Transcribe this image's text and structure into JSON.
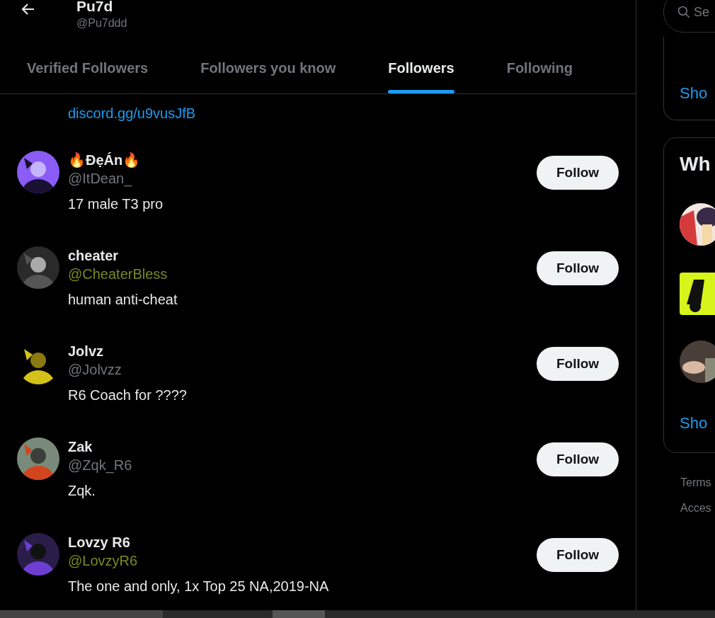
{
  "header": {
    "title": "Pu7d",
    "handle": "@Pu7ddd"
  },
  "tabs": [
    {
      "label": "Verified Followers",
      "selected": false
    },
    {
      "label": "Followers you know",
      "selected": false
    },
    {
      "label": "Followers",
      "selected": true
    },
    {
      "label": "Following",
      "selected": false
    }
  ],
  "partial_user": {
    "bio": "discord.gg/u9vusJfB"
  },
  "users": [
    {
      "name": "🔥ĐẹÁn🔥",
      "handle": "@ItDean_",
      "color": "#71767b",
      "bio": "17 male T3 pro",
      "follow": "Follow"
    },
    {
      "name": "cheater",
      "handle": "@CheaterBless",
      "color": "#7a8a1f",
      "bio": "human anti-cheat",
      "follow": "Follow"
    },
    {
      "name": "Jolvz",
      "handle": "@Jolvzz",
      "color": "#71767b",
      "bio": "R6 Coach for ????",
      "follow": "Follow"
    },
    {
      "name": "Zak",
      "handle": "@Zqk_R6",
      "color": "#71767b",
      "bio": "Zqk.",
      "follow": "Follow"
    },
    {
      "name": "Lovzy R6",
      "handle": "@LovzyR6",
      "color": "#7a8a1f",
      "bio": "The one and only, 1x Top 25 NA,2019-NA",
      "follow": "Follow"
    }
  ],
  "sidebar": {
    "search": {
      "placeholder": "Se"
    },
    "card_1_link": "Sho",
    "card_2_title": "Wh",
    "card_2_link": "Sho",
    "footer": [
      "Terms",
      "Acces"
    ]
  }
}
